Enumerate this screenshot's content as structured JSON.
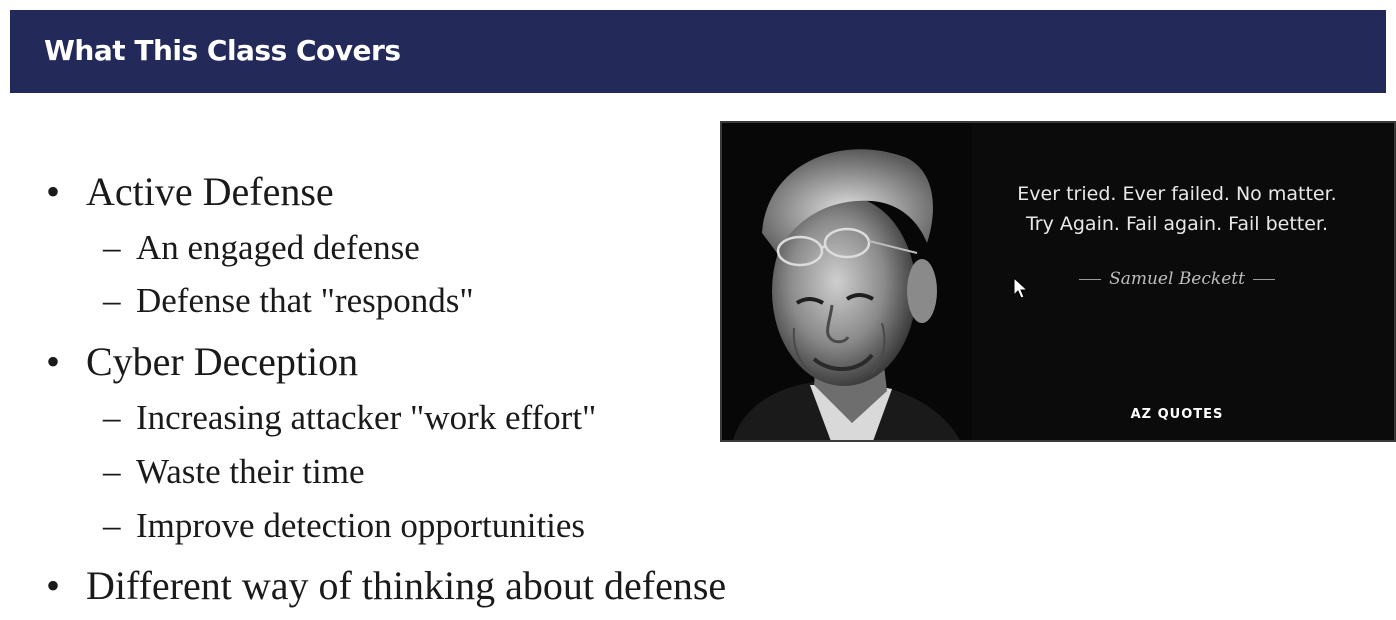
{
  "slide": {
    "title": "What This Class Covers"
  },
  "bullets": [
    {
      "text": "Active Defense",
      "subitems": [
        "An engaged defense",
        "Defense that \"responds\""
      ]
    },
    {
      "text": "Cyber Deception",
      "subitems": [
        "Increasing attacker \"work effort\"",
        "Waste their time",
        "Improve detection opportunities"
      ]
    },
    {
      "text": "Different way of thinking about defense",
      "subitems": []
    }
  ],
  "markers": {
    "bullet": "•",
    "dash": "–"
  },
  "quote_image": {
    "line1": "Ever tried. Ever failed. No matter.",
    "line2": "Try Again. Fail again. Fail better.",
    "author": "Samuel Beckett",
    "brand": "AZ QUOTES"
  },
  "colors": {
    "title_bar": "#232a5a",
    "title_text": "#ffffff",
    "quote_bg": "#0b0b0b"
  }
}
